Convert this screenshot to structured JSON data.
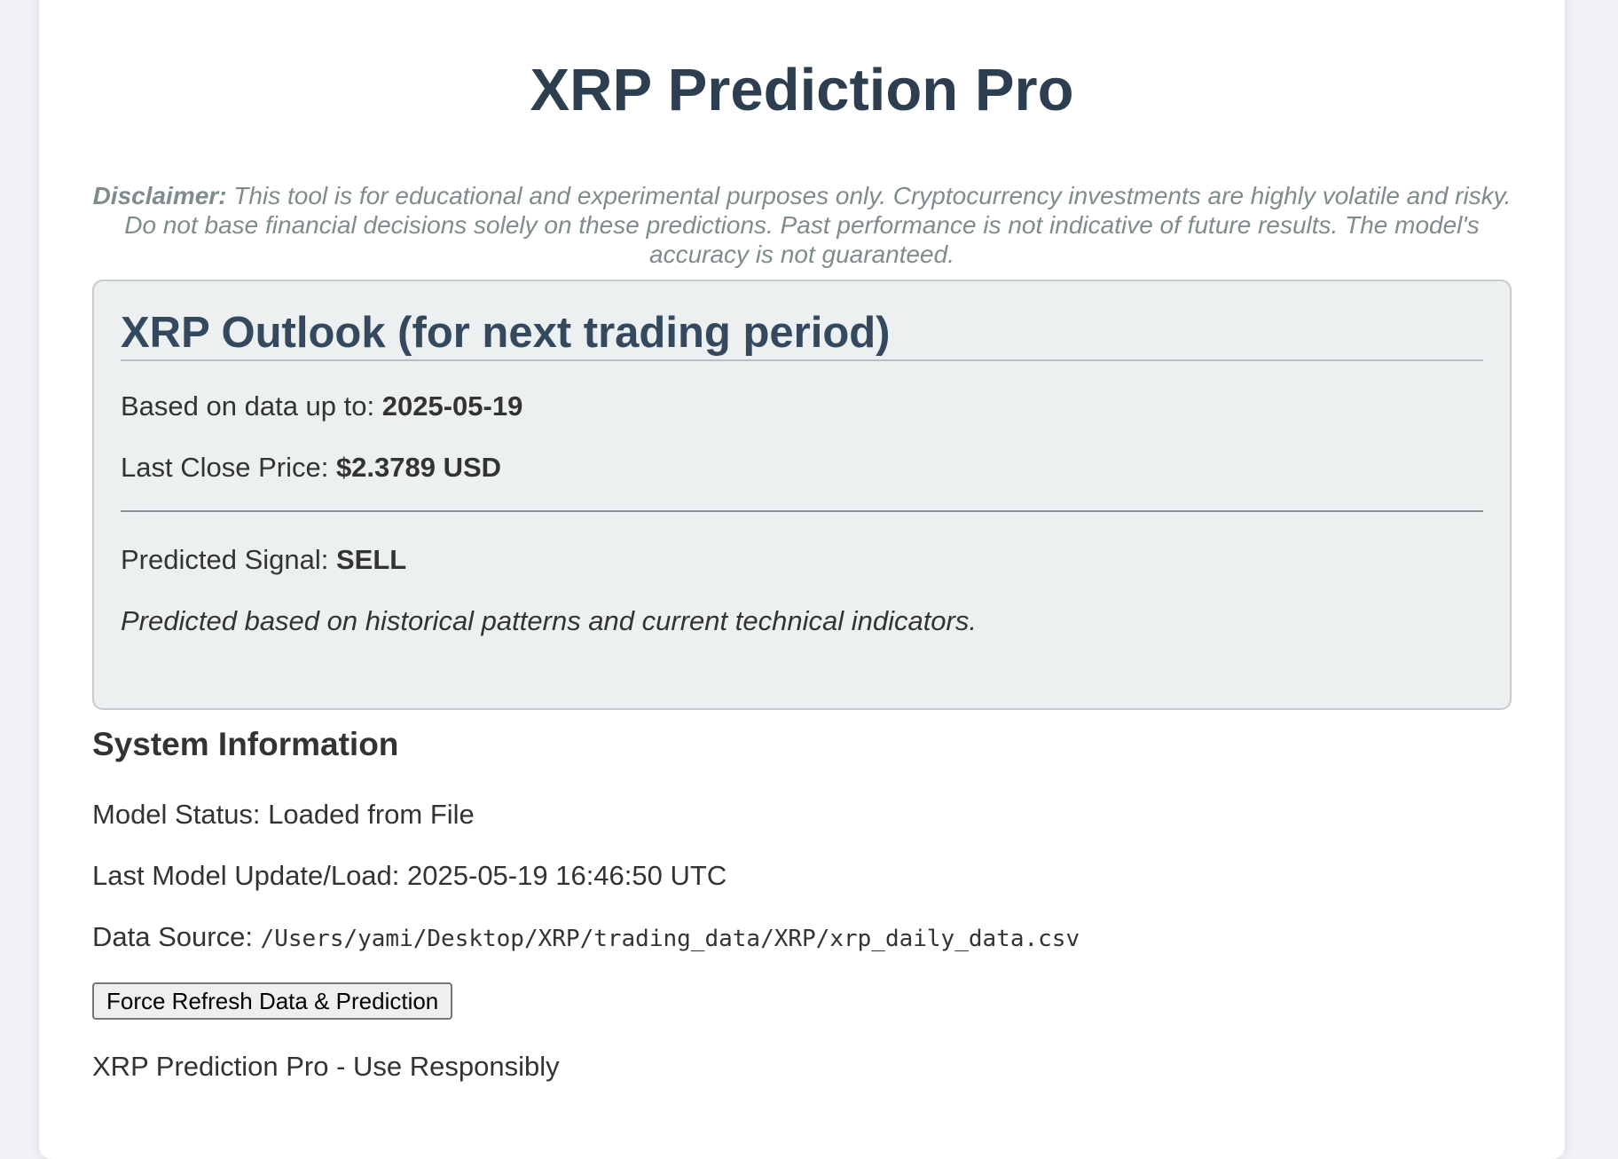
{
  "app": {
    "title": "XRP Prediction Pro",
    "disclaimer_label": "Disclaimer:",
    "disclaimer_text": " This tool is for educational and experimental purposes only. Cryptocurrency investments are highly volatile and risky. Do not base financial decisions solely on these predictions. Past performance is not indicative of future results. The model's accuracy is not guaranteed."
  },
  "outlook": {
    "heading": "XRP Outlook (for next trading period)",
    "data_date_label": "Based on data up to: ",
    "data_date_value": "2025-05-19",
    "last_close_label": "Last Close Price: ",
    "last_close_value": "$2.3789 USD",
    "signal_label": "Predicted Signal: ",
    "signal_value": "SELL",
    "note": "Predicted based on historical patterns and current technical indicators."
  },
  "system": {
    "heading": "System Information",
    "model_status_label": "Model Status: ",
    "model_status_value": "Loaded from File",
    "last_update_label": "Last Model Update/Load: ",
    "last_update_value": "2025-05-19 16:46:50 UTC",
    "data_source_label": "Data Source: ",
    "data_source_value": "/Users/yami/Desktop/XRP/trading_data/XRP/xrp_daily_data.csv",
    "refresh_button": "Force Refresh Data & Prediction",
    "footer": "XRP Prediction Pro - Use Responsibly"
  },
  "colors": {
    "title": "#2c3e50",
    "outlook_heading": "#34495e",
    "disclaimer": "#7f8c8d",
    "outlook_bg": "#ecf0f1",
    "page_bg": "#f0f2f5"
  }
}
